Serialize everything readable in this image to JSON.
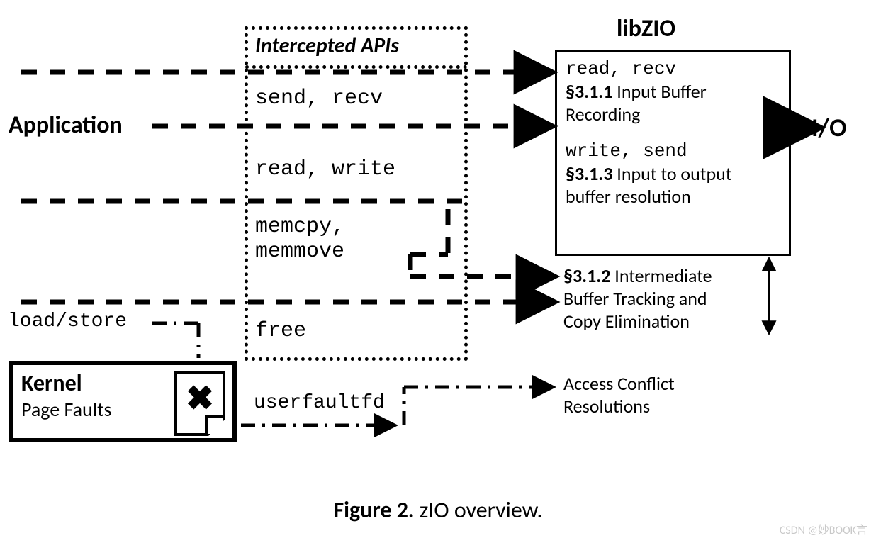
{
  "labels": {
    "application": "Application",
    "libzio": "libZIO",
    "io": "I/O",
    "load_store": "load/store",
    "userfaultfd": "userfaultfd"
  },
  "intercepted": {
    "title": "Intercepted APIs",
    "row1": "send, recv",
    "row2": "read, write",
    "row3a": "memcpy,",
    "row3b": "memmove",
    "row4": "free"
  },
  "zio": {
    "block1_code": "read, recv",
    "block1_sec": "§3.1.1",
    "block1_desc": "Input Buffer Recording",
    "block2_code": "write, send",
    "block2_sec": "§3.1.3",
    "block2_desc": "Input to output buffer resolution"
  },
  "tracking": {
    "sec": "§3.1.2",
    "line1_rest": "Intermediate",
    "line2": "Buffer Tracking and",
    "line3": "Copy Elimination"
  },
  "conflict": {
    "line1": "Access Conflict",
    "line2": "Resolutions"
  },
  "kernel": {
    "title": "Kernel",
    "sub": "Page Faults"
  },
  "caption": {
    "figno": "Figure 2.",
    "text": "zIO overview."
  },
  "watermark": "CSDN @妙BOOK言"
}
